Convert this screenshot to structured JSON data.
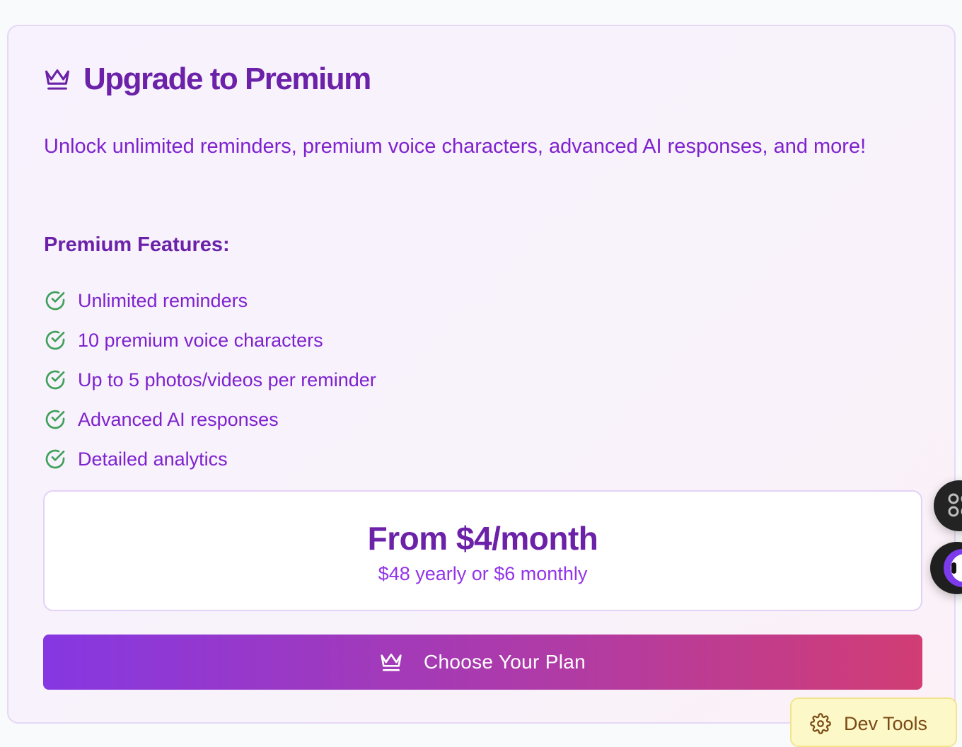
{
  "card": {
    "title": "Upgrade to Premium",
    "subtitle": "Unlock unlimited reminders, premium voice characters, advanced AI responses, and more!",
    "features_heading": "Premium Features:",
    "features": [
      "Unlimited reminders",
      "10 premium voice characters",
      "Up to 5 photos/videos per reminder",
      "Advanced AI responses",
      "Detailed analytics"
    ]
  },
  "pricing": {
    "headline": "From $4/month",
    "detail": "$48 yearly or $6 monthly"
  },
  "cta": {
    "label": "Choose Your Plan"
  },
  "dev_tools": {
    "label": "Dev Tools"
  },
  "colors": {
    "accent_purple": "#6b21a8",
    "text_purple": "#7e22ce",
    "check_green": "#3fa05a",
    "button_gradient_start": "#8637e2",
    "button_gradient_end": "#d13d74"
  },
  "icons": {
    "title": "crown-icon",
    "feature": "check-circle-icon",
    "cta": "crown-icon",
    "dev_tools": "gear-icon",
    "floating_top": "command-icon",
    "floating_bottom": "assistant-icon"
  }
}
